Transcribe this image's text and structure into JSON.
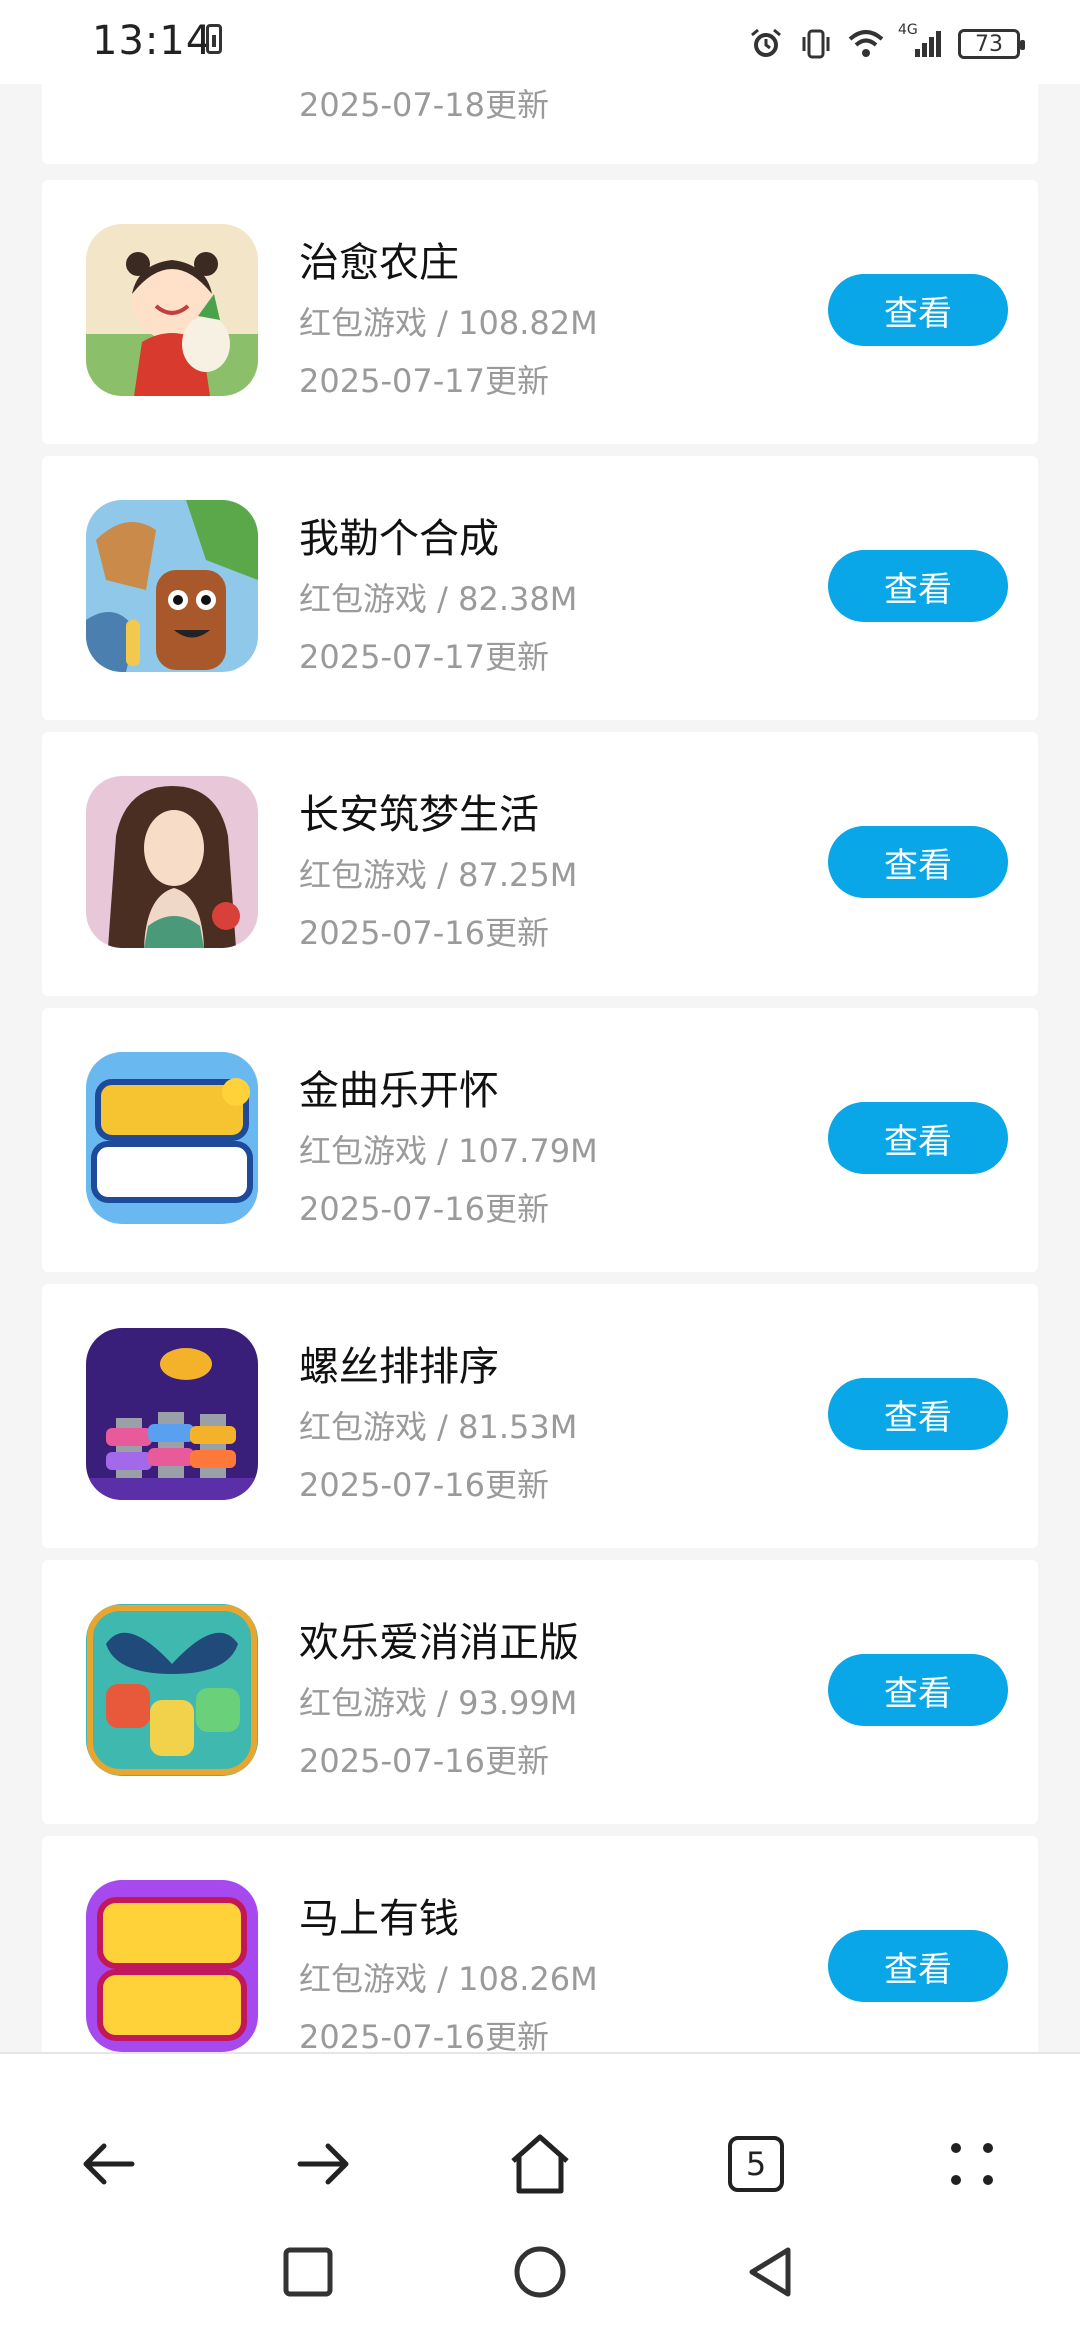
{
  "status_bar": {
    "time": "13:14",
    "network_label": "4G",
    "battery_level": "73"
  },
  "list": {
    "view_label": "查看",
    "items": [
      {
        "title": "",
        "meta": "",
        "date": "2025-07-18更新",
        "icon": "farm-icon"
      },
      {
        "title": "治愈农庄",
        "meta": "红包游戏 / 108.82M",
        "date": "2025-07-17更新",
        "icon": "girl-farm-icon"
      },
      {
        "title": "我勒个合成",
        "meta": "红包游戏 / 82.38M",
        "date": "2025-07-17更新",
        "icon": "characters-icon"
      },
      {
        "title": "长安筑梦生活",
        "meta": "红包游戏 / 87.25M",
        "date": "2025-07-16更新",
        "icon": "woman-portrait-icon"
      },
      {
        "title": "金曲乐开怀",
        "meta": "红包游戏 / 107.79M",
        "date": "2025-07-16更新",
        "icon": "golden-text-icon"
      },
      {
        "title": "螺丝排排序",
        "meta": "红包游戏 / 81.53M",
        "date": "2025-07-16更新",
        "icon": "screw-sort-icon"
      },
      {
        "title": "欢乐爱消消正版",
        "meta": "红包游戏 / 93.99M",
        "date": "2025-07-16更新",
        "icon": "butterfly-puzzle-icon"
      },
      {
        "title": "马上有钱",
        "meta": "红包游戏 / 108.26M",
        "date": "2025-07-16更新",
        "icon": "money-text-icon"
      }
    ]
  },
  "toolbar": {
    "tabs_count": "5"
  },
  "colors": {
    "accent": "#0aa7e8",
    "background": "#f5f5f5"
  }
}
